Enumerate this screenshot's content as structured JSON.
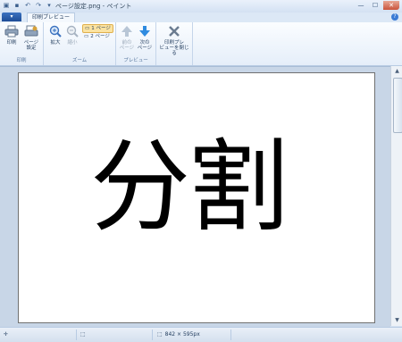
{
  "window": {
    "title": "ページ設定.png - ペイント"
  },
  "tabs": {
    "app_button": "▾",
    "active_tab": "印刷プレビュー"
  },
  "ribbon": {
    "print_group": {
      "label": "印刷",
      "print_btn": "印刷",
      "page_setup_btn_line1": "ページ",
      "page_setup_btn_line2": "設定"
    },
    "zoom_group": {
      "label": "ズーム",
      "zoom_in": "拡大",
      "zoom_out": "縮小",
      "one_page": "1 ページ",
      "two_page": "2 ページ"
    },
    "preview_group": {
      "label": "プレビュー",
      "prev_line1": "前の",
      "prev_line2": "ページ",
      "next_line1": "次の",
      "next_line2": "ページ"
    },
    "close_group": {
      "close_line1": "印刷プレ",
      "close_line2": "ビューを閉じる"
    }
  },
  "document": {
    "text": "分割"
  },
  "statusbar": {
    "image_size": "842 × 595px"
  }
}
